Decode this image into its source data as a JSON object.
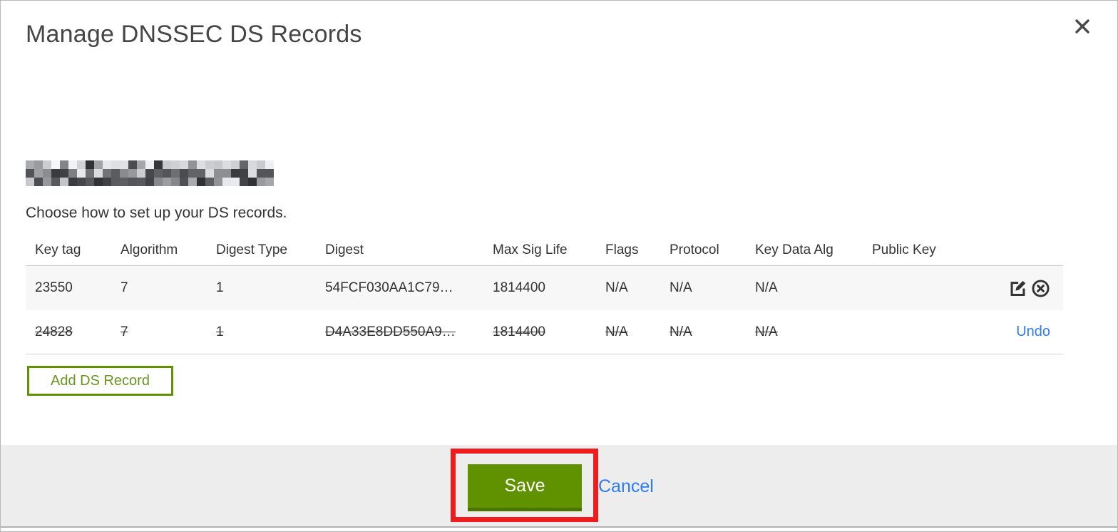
{
  "modal": {
    "title": "Manage DNSSEC DS Records",
    "instruction": "Choose how to set up your DS records.",
    "domain_redacted": true
  },
  "table": {
    "columns": [
      "Key tag",
      "Algorithm",
      "Digest Type",
      "Digest",
      "Max Sig Life",
      "Flags",
      "Protocol",
      "Key Data Alg",
      "Public Key"
    ],
    "rows": [
      {
        "key_tag": "23550",
        "algorithm": "7",
        "digest_type": "1",
        "digest": "54FCF030AA1C79…",
        "max_sig_life": "1814400",
        "flags": "N/A",
        "protocol": "N/A",
        "key_data_alg": "N/A",
        "public_key": "",
        "state": "normal"
      },
      {
        "key_tag": "24828",
        "algorithm": "7",
        "digest_type": "1",
        "digest": "D4A33E8DD550A9…",
        "max_sig_life": "1814400",
        "flags": "N/A",
        "protocol": "N/A",
        "key_data_alg": "N/A",
        "public_key": "",
        "state": "deleted",
        "action_label": "Undo"
      }
    ]
  },
  "buttons": {
    "add_ds_record": "Add DS Record",
    "save": "Save",
    "cancel": "Cancel"
  },
  "icons": {
    "close": "close-icon",
    "edit": "edit-record-icon",
    "delete": "delete-record-icon"
  },
  "colors": {
    "accent_green": "#5f9400",
    "save_green": "#609200",
    "save_green_dark": "#4a7300",
    "link_blue": "#2d7cf2",
    "annotation_red": "#ee1d1d",
    "footer_bg": "#ededed",
    "row_stripe": "#f7f7f7",
    "text": "#333333"
  }
}
